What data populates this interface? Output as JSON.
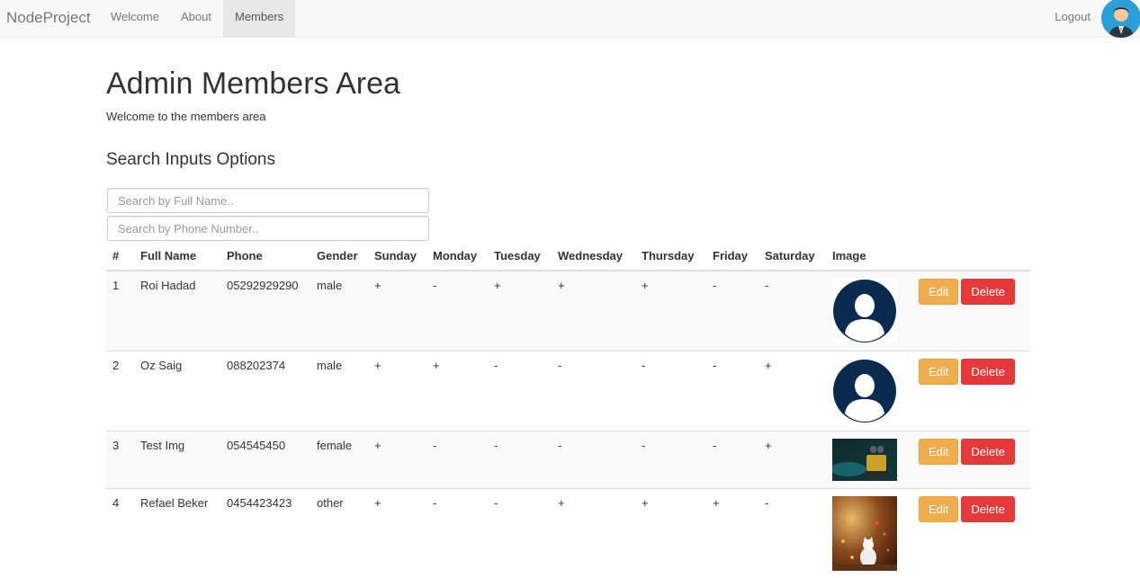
{
  "nav": {
    "brand": "NodeProject",
    "links": [
      {
        "label": "Welcome",
        "active": false
      },
      {
        "label": "About",
        "active": false
      },
      {
        "label": "Members",
        "active": true
      }
    ],
    "logout": "Logout"
  },
  "page": {
    "title": "Admin Members Area",
    "welcome": "Welcome to the members area",
    "search_heading": "Search Inputs Options",
    "search_name_placeholder": "Search by Full Name..",
    "search_phone_placeholder": "Search by Phone Number.."
  },
  "table": {
    "headers": [
      "#",
      "Full Name",
      "Phone",
      "Gender",
      "Sunday",
      "Monday",
      "Tuesday",
      "Wednesday",
      "Thursday",
      "Friday",
      "Saturday",
      "Image",
      ""
    ],
    "rows": [
      {
        "num": "1",
        "name": "Roi Hadad",
        "phone": "05292929290",
        "gender": "male",
        "days": [
          "+",
          "-",
          "+",
          "+",
          "+",
          "-",
          "-"
        ],
        "image": "default-avatar"
      },
      {
        "num": "2",
        "name": "Oz Saig",
        "phone": "088202374",
        "gender": "male",
        "days": [
          "+",
          "+",
          "-",
          "-",
          "-",
          "-",
          "+"
        ],
        "image": "default-avatar"
      },
      {
        "num": "3",
        "name": "Test Img",
        "phone": "054545450",
        "gender": "female",
        "days": [
          "+",
          "-",
          "-",
          "-",
          "-",
          "-",
          "+"
        ],
        "image": "robot-photo"
      },
      {
        "num": "4",
        "name": "Refael Beker",
        "phone": "0454423423",
        "gender": "other",
        "days": [
          "+",
          "-",
          "-",
          "+",
          "+",
          "+",
          "-"
        ],
        "image": "cat-photo"
      }
    ],
    "edit_label": "Edit",
    "delete_label": "Delete"
  }
}
